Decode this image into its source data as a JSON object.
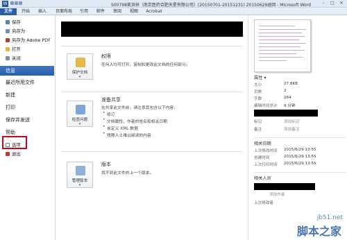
{
  "window": {
    "app_icon": "W",
    "title": "S00798美洪祥（南京医药合肥天星有限公司）(20150701-20151231) 20150629退回 - Microsoft Word",
    "controls": [
      "–",
      "□",
      "✕"
    ]
  },
  "ribbon": {
    "tabs": [
      "文件",
      "开始",
      "插入",
      "页面布局",
      "引用",
      "邮件",
      "审阅",
      "视图",
      "Acrobat"
    ]
  },
  "nav": {
    "save": "保存",
    "save_as": "另存为",
    "save_as_pdf": "另存为 Adobe PDF",
    "open": "打开",
    "close": "关闭",
    "info": "信息",
    "recent": "最近所用文件",
    "new": "新建",
    "print": "打印",
    "save_send": "保存并发送",
    "help": "帮助",
    "options": "选项",
    "exit": "退出"
  },
  "info": {
    "permissions": {
      "tile_label": "保护文档",
      "tile_caret": "▾",
      "heading": "权限",
      "description": "任何人均可打开、复制和更改此文档的任何部分。"
    },
    "prepare": {
      "tile_label": "检查问题",
      "tile_caret": "▾",
      "heading": "准备共享",
      "description": "在共享此文件前，请注意其包含以下内容:",
      "bullets": [
        "修订",
        "文档属性、作者的姓名和相关日期",
        "自定义 XML 数据",
        "残障人士难以阅读的内容"
      ]
    },
    "versions": {
      "tile_label": "管理版本",
      "tile_caret": "▾",
      "heading": "版本",
      "description": "找不到此文件的上一个版本。"
    }
  },
  "properties": {
    "heading": "属性 ▾",
    "size_label": "大小",
    "size_value": "27.8KB",
    "pages_label": "页数",
    "pages_value": "2",
    "words_label": "字数",
    "words_value": "264",
    "edit_time_label": "编辑时间总计",
    "edit_time_value": "9 分钟",
    "tags_label": "标记",
    "tags_value": "添加标记",
    "comments_label": "备注",
    "comments_value": "添加备注",
    "dates_heading": "相关日期",
    "modified_label": "上次修改时间",
    "modified_value": "2015/6/29 13:55",
    "created_label": "创建时间",
    "created_value": "2015/6/29 13:55",
    "printed_label": "上次打印时间",
    "printed_value": "2015/6/29 13:55",
    "people_heading": "相关人员",
    "author_value": "添加作者",
    "last_modified_by_label": "上次修改者"
  },
  "watermark": {
    "domain": "jb51.net",
    "brand": "脚本之家"
  },
  "colors": {
    "file_tab": "#2a5ea8",
    "active_nav": "#2a5ea8",
    "highlight_box": "#d0021b"
  }
}
